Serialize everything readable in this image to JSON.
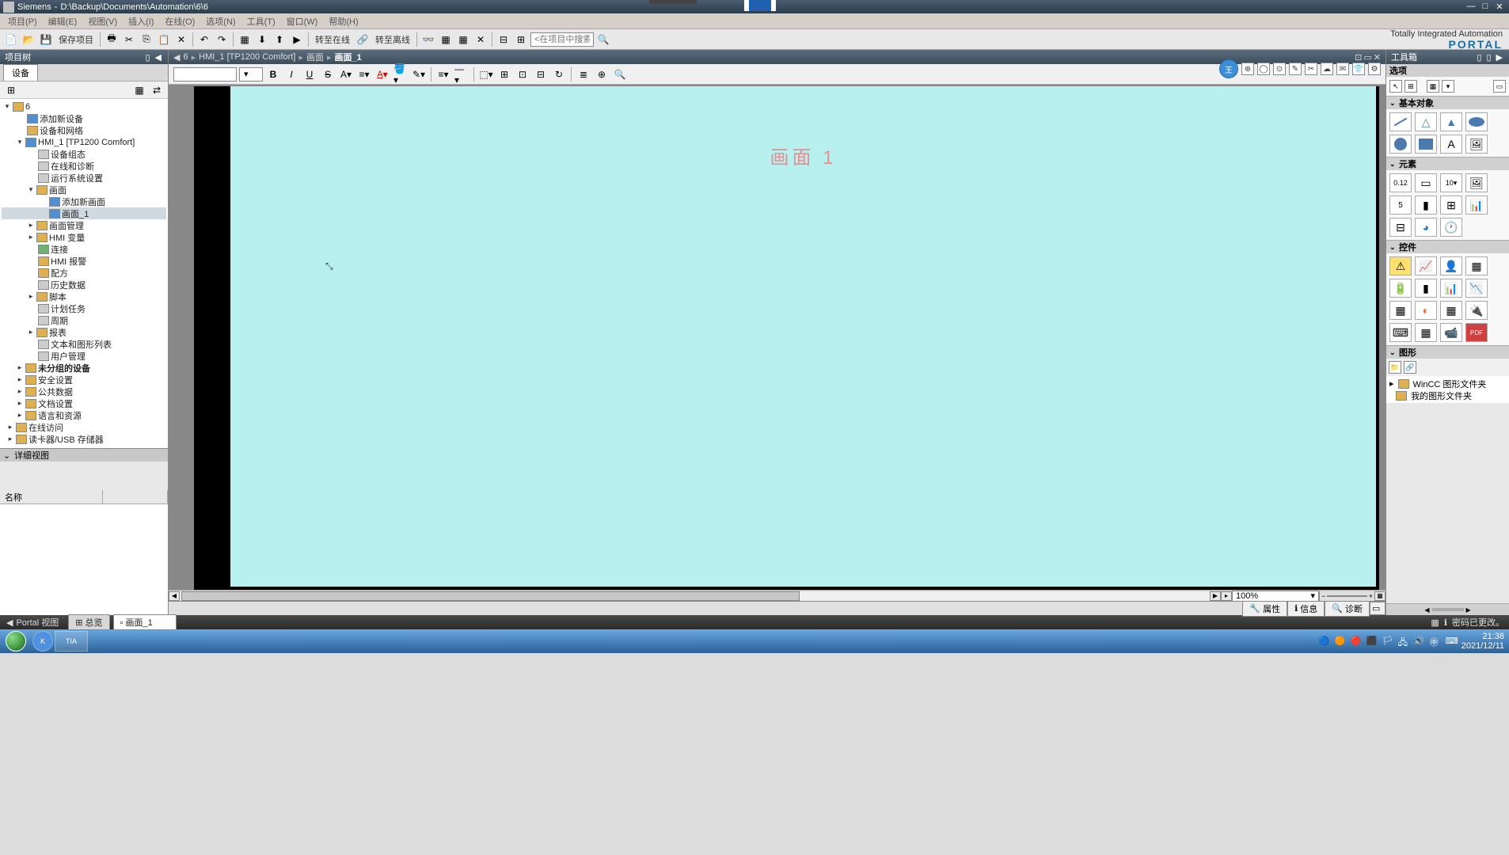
{
  "title_bar": {
    "app": "Siemens",
    "sep": "-",
    "path": "D:\\Backup\\Documents\\Automation\\6\\6"
  },
  "menu": {
    "project": "项目(P)",
    "edit": "编辑(E)",
    "view": "视图(V)",
    "insert": "插入(I)",
    "online": "在线(O)",
    "options": "选项(N)",
    "tools": "工具(T)",
    "window": "窗口(W)",
    "help": "帮助(H)"
  },
  "toolbar": {
    "save": "保存项目",
    "go_online": "转至在线",
    "go_offline": "转至离线",
    "search_placeholder": "<在项目中搜索>",
    "tia_line1": "Totally Integrated Automation",
    "tia_line2": "PORTAL"
  },
  "project_tree": {
    "header": "项目树",
    "tab": "设备",
    "root": "6",
    "nodes": {
      "add_device": "添加新设备",
      "devices_networks": "设备和网络",
      "hmi": "HMI_1 [TP1200 Comfort]",
      "device_config": "设备组态",
      "online_diag": "在线和诊断",
      "runtime_settings": "运行系统设置",
      "screens": "画面",
      "add_screen": "添加新画面",
      "screen_1": "画面_1",
      "screen_mgmt": "画面管理",
      "hmi_tags": "HMI 变量",
      "connections": "连接",
      "hmi_alarms": "HMI 报警",
      "recipes": "配方",
      "historical": "历史数据",
      "scripts": "脚本",
      "scheduled": "计划任务",
      "cycles": "周期",
      "reports": "报表",
      "text_graphic": "文本和图形列表",
      "user_admin": "用户管理",
      "ungrouped": "未分组的设备",
      "security": "安全设置",
      "common": "公共数据",
      "doc_settings": "文档设置",
      "lang_res": "语言和资源",
      "online_access": "在线访问",
      "card_reader": "读卡器/USB 存储器"
    }
  },
  "detail": {
    "header": "详细视图",
    "col_name": "名称"
  },
  "breadcrumb": {
    "p1": "6",
    "p2": "HMI_1 [TP1200 Comfort]",
    "p3": "画面",
    "p4": "画面_1"
  },
  "canvas": {
    "screen_title": "画面 1"
  },
  "zoom": {
    "value": "100%"
  },
  "status_tabs": {
    "properties": "属性",
    "info": "信息",
    "diagnostics": "诊断"
  },
  "toolbox": {
    "header": "工具箱",
    "options": "选项",
    "basic": "基本对象",
    "text_A": "A",
    "elements": "元素",
    "elem_io": "0.12",
    "elem_btn": "10▾",
    "elem_date": "5",
    "controls": "控件",
    "ctrl_pdf": "PDF",
    "graphics": "图形",
    "wincc_folder": "WinCC 图形文件夹",
    "my_folder": "我的图形文件夹"
  },
  "bottom_bar": {
    "portal_view": "Portal 视图",
    "overview": "总览",
    "doc_tab": "画面_1",
    "pwd_changed": "密码已更改。"
  },
  "taskbar": {
    "k": "K",
    "tia": "TIA",
    "time": "21:38",
    "date": "2021/12/11"
  }
}
